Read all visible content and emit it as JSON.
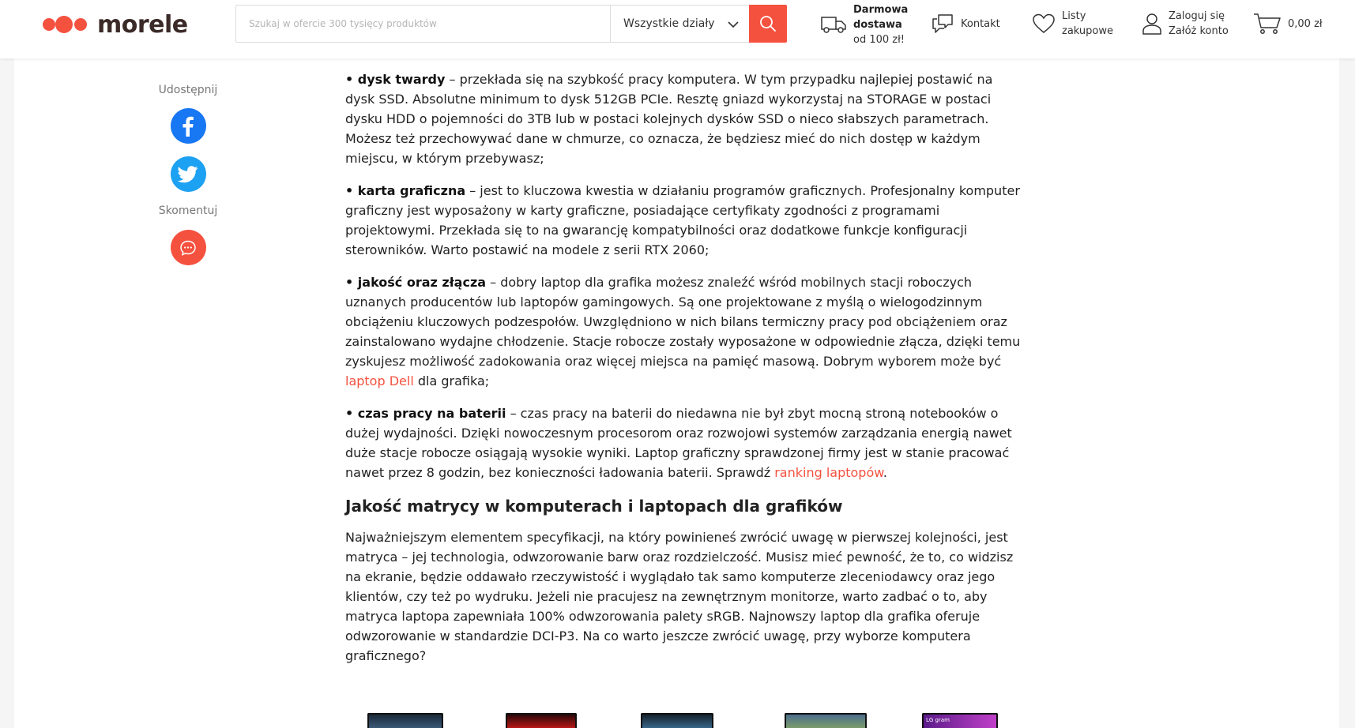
{
  "header": {
    "logo_text": "morele",
    "search": {
      "placeholder": "Szukaj w ofercie 300 tysięcy produktów",
      "value": "",
      "category": "Wszystkie działy"
    },
    "delivery": {
      "line1": "Darmowa",
      "line2": "dostawa",
      "line3": "od 100 zł!"
    },
    "contact": "Kontakt",
    "lists": {
      "line1": "Listy",
      "line2": "zakupowe"
    },
    "login": {
      "line1": "Zaloguj się",
      "line2": "Załóż konto"
    },
    "cart_total": "0,00 zł",
    "accent_color": "#f5513f"
  },
  "sidebar": {
    "share_label": "Udostępnij",
    "comment_label": "Skomentuj",
    "icons": [
      "facebook-icon",
      "twitter-icon",
      "comment-icon"
    ]
  },
  "article": {
    "items": [
      {
        "term": "• dysk twardy",
        "text": " – przekłada się na szybkość pracy komputera. W tym przypadku najlepiej postawić na dysk SSD. Absolutne minimum to dysk 512GB PCIe. Resztę gniazd wykorzystaj na STORAGE w postaci dysku HDD o pojemności do 3TB lub w postaci kolejnych dysków SSD o nieco słabszych parametrach. Możesz też przechowywać dane w chmurze, co oznacza, że będziesz mieć do nich dostęp w każdym miejscu, w którym przebywasz;"
      },
      {
        "term": "• karta graficzna",
        "text": " – jest to kluczowa kwestia w działaniu programów graficznych. Profesjonalny komputer graficzny jest wyposażony w karty graficzne, posiadające certyfikaty zgodności z programami projektowymi. Przekłada się to na gwarancję kompatybilności oraz dodatkowe funkcje konfiguracji sterowników. Warto postawić na modele z serii RTX 2060;"
      },
      {
        "term": "• jakość oraz złącza",
        "text": " – dobry laptop dla grafika możesz znaleźć wśród mobilnych stacji roboczych uznanych producentów lub laptopów gamingowych. Są one projektowane z myślą o wielogodzinnym obciążeniu kluczowych podzespołów. Uwzględniono w nich bilans termiczny pracy pod obciążeniem oraz zainstalowano wydajne chłodzenie. Stacje robocze zostały wyposażone w odpowiednie złącza, dzięki temu zyskujesz możliwość zadokowania oraz więcej miejsca na pamięć masową. Dobrym wyborem może być ",
        "link": "laptop Dell",
        "after": " dla grafika;"
      },
      {
        "term": "• czas pracy na baterii",
        "text": " – czas pracy na baterii do niedawna nie był zbyt mocną stroną notebooków o dużej wydajności. Dzięki nowoczesnym procesorom oraz rozwojowi systemów zarządzania energią nawet duże stacje robocze osiągają wysokie wyniki. Laptop graficzny sprawdzonej firmy jest w stanie pracować nawet przez 8 godzin, bez konieczności ładowania baterii. Sprawdź ",
        "link": "ranking laptopów",
        "after": "."
      }
    ],
    "heading": "Jakość matrycy w komputerach i laptopach dla grafików",
    "paragraph": "Najważniejszym elementem specyfikacji, na który powinieneś zwrócić uwagę w pierwszej kolejności, jest matryca – jej technologia, odwzorowanie barw oraz rozdzielczość. Musisz mieć pewność, że to, co widzisz na ekranie, będzie oddawało rzeczywistość i wyglądało tak samo komputerze zleceniodawcy oraz jego klientów, czy też po wydruku. Jeżeli nie pracujesz na zewnętrznym monitorze, warto zadbać o to, aby matryca laptopa zapewniała 100% odwzorowania palety sRGB. Najnowszy laptop dla grafika oferuje odwzorowanie w standardzie DCI-P3. Na co warto jeszcze zwrócić uwagę, przy wyborze komputera graficznego?",
    "product_thumbs_label": "LG gram"
  }
}
